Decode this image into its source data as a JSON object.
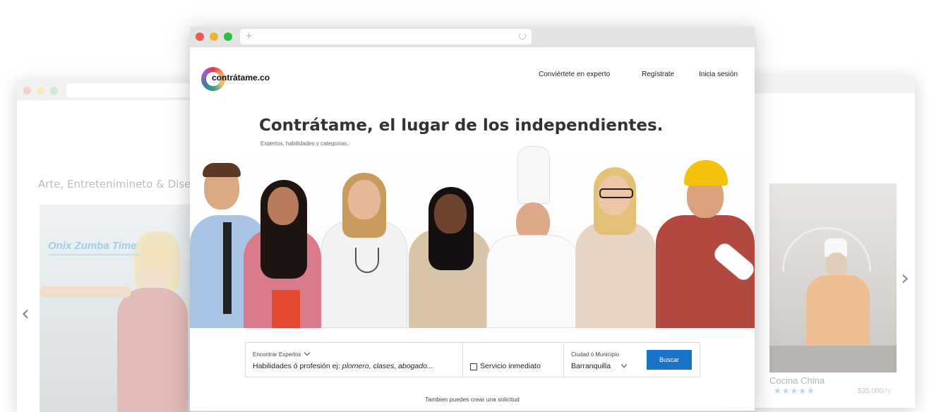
{
  "left_window": {
    "heading": "Arte, Entretenimineto & Diseño",
    "card_title": "Onix Zumba Time"
  },
  "right_window": {
    "card_title": "Cocina China",
    "rating_stars": "★★★★★",
    "price": "$35.000",
    "price_unit": "/hr"
  },
  "carousel": {
    "prev_icon": "‹",
    "next_icon": "›"
  },
  "main": {
    "address_plus": "+",
    "logo_text": "contrátame.co",
    "nav": {
      "become_expert": "Conviértete en experto",
      "register": "Regístrate",
      "login": "Inicia sesión"
    },
    "hero": {
      "title": "Contrátame, el lugar de los independientes.",
      "subtitle": "Expertos, habilidades y categorías."
    },
    "search": {
      "find_label": "Encontrar Expertos",
      "find_value_prefix": "Habilidades ó profesión ej: ",
      "find_value_example": "plomero, clases, abogado...",
      "immediate_label": "Servicio inmediato",
      "city_label": "Ciudad ó Municipio",
      "city_value": "Barranquilla",
      "button": "Buscar"
    },
    "also_text": "Tambien puedes crear una solicitud"
  },
  "colors": {
    "accent": "#1a73c9",
    "left_title": "#4fa7d8"
  }
}
